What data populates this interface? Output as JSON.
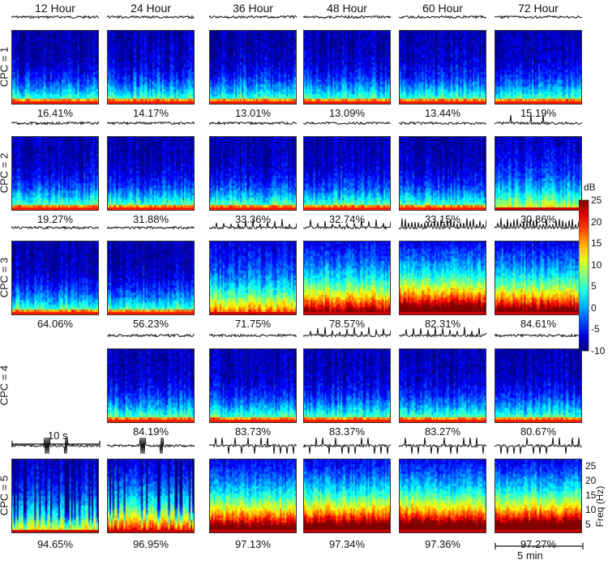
{
  "columns": [
    "12 Hour",
    "24 Hour",
    "36 Hour",
    "48 Hour",
    "60 Hour",
    "72 Hour"
  ],
  "rows": [
    {
      "label": "CPC = 1",
      "panels": [
        {
          "pct": "16.41%",
          "intensity": 0.1,
          "trace": "low"
        },
        {
          "pct": "14.17%",
          "intensity": 0.09,
          "trace": "low"
        },
        {
          "pct": "13.01%",
          "intensity": 0.1,
          "trace": "low"
        },
        {
          "pct": "13.09%",
          "intensity": 0.1,
          "trace": "low"
        },
        {
          "pct": "13.44%",
          "intensity": 0.1,
          "trace": "low"
        },
        {
          "pct": "15.19%",
          "intensity": 0.08,
          "trace": "low"
        }
      ]
    },
    {
      "label": "CPC = 2",
      "panels": [
        {
          "pct": "19.27%",
          "intensity": 0.1,
          "trace": "low"
        },
        {
          "pct": "31.88%",
          "intensity": 0.08,
          "trace": "low"
        },
        {
          "pct": "33.36%",
          "intensity": 0.1,
          "trace": "low"
        },
        {
          "pct": "32.74%",
          "intensity": 0.12,
          "trace": "low"
        },
        {
          "pct": "33.15%",
          "intensity": 0.14,
          "trace": "low"
        },
        {
          "pct": "30.86%",
          "intensity": 0.2,
          "trace": "spikes"
        }
      ]
    },
    {
      "label": "CPC = 3",
      "panels": [
        {
          "pct": "64.06%",
          "intensity": 0.06,
          "trace": "low"
        },
        {
          "pct": "56.23%",
          "intensity": 0.08,
          "trace": "low"
        },
        {
          "pct": "71.75%",
          "intensity": 0.35,
          "trace": "mid"
        },
        {
          "pct": "78.57%",
          "intensity": 0.55,
          "trace": "mid"
        },
        {
          "pct": "82.31%",
          "intensity": 0.7,
          "trace": "high"
        },
        {
          "pct": "84.61%",
          "intensity": 0.62,
          "trace": "high"
        }
      ]
    },
    {
      "label": "CPC = 4",
      "panels": [
        null,
        {
          "pct": "84.19%",
          "intensity": 0.08,
          "trace": "low"
        },
        {
          "pct": "83.73%",
          "intensity": 0.08,
          "trace": "low"
        },
        {
          "pct": "83.37%",
          "intensity": 0.1,
          "trace": "mid"
        },
        {
          "pct": "83.27%",
          "intensity": 0.12,
          "trace": "mid"
        },
        {
          "pct": "80.67%",
          "intensity": 0.14,
          "trace": "low"
        }
      ]
    },
    {
      "label": "CPC = 5",
      "panels": [
        {
          "pct": "94.65%",
          "intensity": 0.25,
          "trace": "burst"
        },
        {
          "pct": "96.95%",
          "intensity": 0.45,
          "trace": "burst"
        },
        {
          "pct": "97.13%",
          "intensity": 0.65,
          "trace": "spiky"
        },
        {
          "pct": "97.34%",
          "intensity": 0.7,
          "trace": "spiky"
        },
        {
          "pct": "97.36%",
          "intensity": 0.72,
          "trace": "spiky"
        },
        {
          "pct": "97.27%",
          "intensity": 0.75,
          "trace": "spiky"
        }
      ]
    }
  ],
  "colorbar": {
    "unit": "dB",
    "ticks": [
      "25",
      "20",
      "15",
      "10",
      "5",
      "0",
      "-5",
      "-10"
    ],
    "min": -10,
    "max": 25
  },
  "freq_axis": {
    "label": "Freq (Hz)",
    "ticks": [
      "25",
      "20",
      "15",
      "10",
      "5"
    ]
  },
  "scale_bars": {
    "time_top": "10 s",
    "time_bottom": "5 min"
  }
}
